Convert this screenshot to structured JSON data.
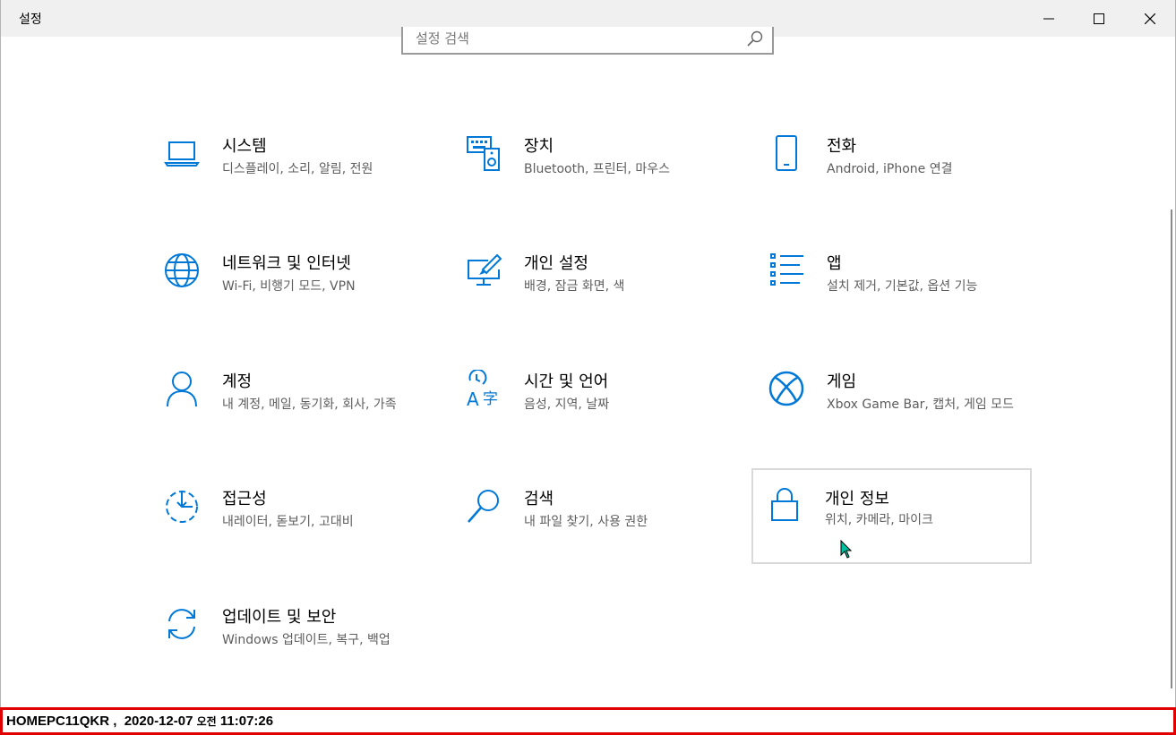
{
  "window": {
    "title": "설정"
  },
  "search": {
    "placeholder": "설정 검색"
  },
  "tiles": [
    {
      "label": "시스템",
      "desc": "디스플레이, 소리, 알림, 전원",
      "icon": "laptop-icon"
    },
    {
      "label": "장치",
      "desc": "Bluetooth, 프린터, 마우스",
      "icon": "devices-icon"
    },
    {
      "label": "전화",
      "desc": "Android, iPhone 연결",
      "icon": "phone-icon"
    },
    {
      "label": "네트워크 및 인터넷",
      "desc": "Wi-Fi, 비행기 모드, VPN",
      "icon": "globe-icon"
    },
    {
      "label": "개인 설정",
      "desc": "배경, 잠금 화면, 색",
      "icon": "personalization-icon"
    },
    {
      "label": "앱",
      "desc": "설치 제거, 기본값, 옵션 기능",
      "icon": "apps-list-icon"
    },
    {
      "label": "계정",
      "desc": "내 계정, 메일, 동기화, 회사, 가족",
      "icon": "person-icon"
    },
    {
      "label": "시간 및 언어",
      "desc": "음성, 지역, 날짜",
      "icon": "time-language-icon"
    },
    {
      "label": "게임",
      "desc": "Xbox Game Bar, 캡처, 게임 모드",
      "icon": "xbox-icon"
    },
    {
      "label": "접근성",
      "desc": "내레이터, 돋보기, 고대비",
      "icon": "ease-of-access-icon"
    },
    {
      "label": "검색",
      "desc": "내 파일 찾기, 사용 권한",
      "icon": "search-icon"
    },
    {
      "label": "개인 정보",
      "desc": "위치, 카메라, 마이크",
      "icon": "lock-icon"
    },
    {
      "label": "업데이트 및 보안",
      "desc": "Windows 업데이트, 복구, 백업",
      "icon": "sync-icon"
    }
  ],
  "statusbar": {
    "host": "HOMEPC11QKR",
    "sep": " ,  ",
    "date": "2020-12-07",
    "ampm": "오전",
    "time": "11:07:26"
  },
  "colors": {
    "accent": "#0078d7",
    "status_border": "#e00000"
  }
}
